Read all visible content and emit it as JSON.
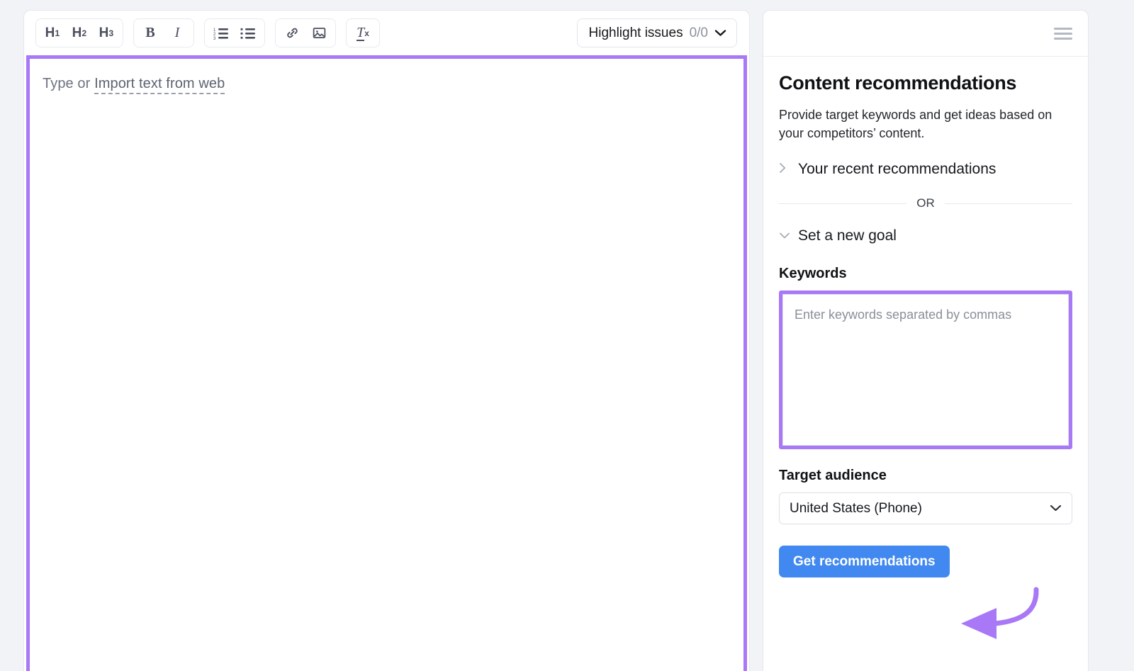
{
  "editor": {
    "toolbar": {
      "heading_buttons": [
        {
          "label": "H",
          "level": "1",
          "icon": "heading-1-icon"
        },
        {
          "label": "H",
          "level": "2",
          "icon": "heading-2-icon"
        },
        {
          "label": "H",
          "level": "3",
          "icon": "heading-3-icon"
        }
      ],
      "bold_label": "B",
      "italic_label": "I",
      "ordered_list_icon": "ordered-list-icon",
      "bullet_list_icon": "bullet-list-icon",
      "link_icon": "link-icon",
      "image_icon": "image-icon",
      "clear_format_label": "T",
      "clear_format_sub": "x",
      "highlight_issues": {
        "label": "Highlight issues",
        "count": "0/0",
        "chevron": "chevron-down-icon"
      }
    },
    "placeholder_prefix": "Type or ",
    "placeholder_link": "Import text from web"
  },
  "panel": {
    "menu_icon": "hamburger-menu-icon",
    "title": "Content recommendations",
    "description": "Provide target keywords and get ideas based on your competitors’ content.",
    "recent_accordion": {
      "label": "Your recent recommendations",
      "chevron": "chevron-right-icon",
      "expanded": "false"
    },
    "divider_label": "OR",
    "new_goal_accordion": {
      "label": "Set a new goal",
      "chevron": "chevron-down-icon",
      "expanded": "true"
    },
    "keywords": {
      "label": "Keywords",
      "value": "",
      "placeholder": "Enter keywords separated by commas"
    },
    "target_audience": {
      "label": "Target audience",
      "selected": "United States (Phone)",
      "chevron": "chevron-down-icon"
    },
    "cta_label": "Get recommendations"
  },
  "colors": {
    "highlight_purple": "#a878f7",
    "cta_blue": "#4189f0",
    "page_background": "#f1f3f7",
    "muted_text": "#8b909c"
  }
}
